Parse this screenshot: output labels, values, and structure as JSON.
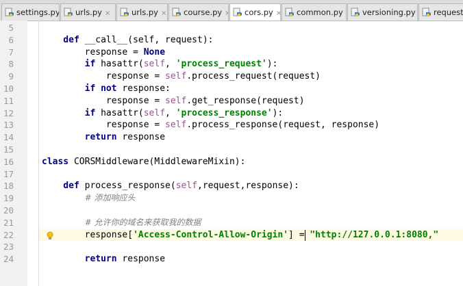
{
  "tabs": [
    {
      "label": "settings.py",
      "active": false
    },
    {
      "label": "urls.py",
      "active": false
    },
    {
      "label": "urls.py",
      "active": false
    },
    {
      "label": "course.py",
      "active": false
    },
    {
      "label": "cors.py",
      "active": true
    },
    {
      "label": "common.py",
      "active": false
    },
    {
      "label": "versioning.py",
      "active": false
    },
    {
      "label": "request.",
      "active": false
    }
  ],
  "editor": {
    "line_numbers": [
      "5",
      "6",
      "7",
      "8",
      "9",
      "10",
      "11",
      "12",
      "13",
      "14",
      "15",
      "16",
      "17",
      "18",
      "19",
      "20",
      "21",
      "22",
      "23",
      "24"
    ],
    "highlighted_line": "22",
    "lines": [
      {
        "n": "5",
        "tokens": []
      },
      {
        "n": "6",
        "tokens": [
          [
            "kw",
            "    def "
          ],
          [
            "func",
            "__call__"
          ],
          [
            "t",
            "(self, request):"
          ]
        ]
      },
      {
        "n": "7",
        "tokens": [
          [
            "t",
            "        response = "
          ],
          [
            "kw",
            "None"
          ]
        ]
      },
      {
        "n": "8",
        "tokens": [
          [
            "t",
            "        "
          ],
          [
            "kw",
            "if "
          ],
          [
            "t",
            "hasattr("
          ],
          [
            "self",
            "self"
          ],
          [
            "t",
            ", "
          ],
          [
            "str",
            "'process_request'"
          ],
          [
            "t",
            "):"
          ]
        ]
      },
      {
        "n": "9",
        "tokens": [
          [
            "t",
            "            response = "
          ],
          [
            "self",
            "self"
          ],
          [
            "t",
            ".process_request(request)"
          ]
        ]
      },
      {
        "n": "10",
        "tokens": [
          [
            "t",
            "        "
          ],
          [
            "kw",
            "if not "
          ],
          [
            "t",
            "response:"
          ]
        ]
      },
      {
        "n": "11",
        "tokens": [
          [
            "t",
            "            response = "
          ],
          [
            "self",
            "self"
          ],
          [
            "t",
            ".get_response(request)"
          ]
        ]
      },
      {
        "n": "12",
        "tokens": [
          [
            "t",
            "        "
          ],
          [
            "kw",
            "if "
          ],
          [
            "t",
            "hasattr("
          ],
          [
            "self",
            "self"
          ],
          [
            "t",
            ", "
          ],
          [
            "str",
            "'process_response'"
          ],
          [
            "t",
            "):"
          ]
        ]
      },
      {
        "n": "13",
        "tokens": [
          [
            "t",
            "            response = "
          ],
          [
            "self",
            "self"
          ],
          [
            "t",
            ".process_response(request, response)"
          ]
        ]
      },
      {
        "n": "14",
        "tokens": [
          [
            "t",
            "        "
          ],
          [
            "kw",
            "return "
          ],
          [
            "t",
            "response"
          ]
        ]
      },
      {
        "n": "15",
        "tokens": []
      },
      {
        "n": "16",
        "tokens": [
          [
            "kw",
            "class "
          ],
          [
            "t",
            "CORSMiddleware(MiddlewareMixin):"
          ]
        ]
      },
      {
        "n": "17",
        "tokens": []
      },
      {
        "n": "18",
        "tokens": [
          [
            "kw",
            "    def "
          ],
          [
            "t",
            "process_response("
          ],
          [
            "self",
            "self"
          ],
          [
            "t",
            ",request,response):"
          ]
        ]
      },
      {
        "n": "19",
        "tokens": [
          [
            "t",
            "        "
          ],
          [
            "cmt",
            "# 添加响应头"
          ]
        ]
      },
      {
        "n": "20",
        "tokens": []
      },
      {
        "n": "21",
        "tokens": [
          [
            "t",
            "        "
          ],
          [
            "cmt",
            "# 允许你的域名来获取我的数据"
          ]
        ]
      },
      {
        "n": "22",
        "tokens": [
          [
            "t",
            "        response["
          ],
          [
            "str",
            "'Access-Control-Allow-Origin'"
          ],
          [
            "t",
            "] = "
          ],
          [
            "str",
            "\"http://127.0.0.1:8080,\""
          ]
        ]
      },
      {
        "n": "23",
        "tokens": []
      },
      {
        "n": "24",
        "tokens": [
          [
            "t",
            "        "
          ],
          [
            "kw",
            "return "
          ],
          [
            "t",
            "response"
          ]
        ]
      }
    ]
  },
  "icons": {
    "tab_file_icon": "python-file-icon",
    "close_icon": "close-icon",
    "gutter_icon": "lightbulb-icon"
  },
  "colors": {
    "keyword": "#000080",
    "self": "#94558d",
    "string": "#008000",
    "comment": "#808080",
    "caret_row": "#fffae3"
  }
}
